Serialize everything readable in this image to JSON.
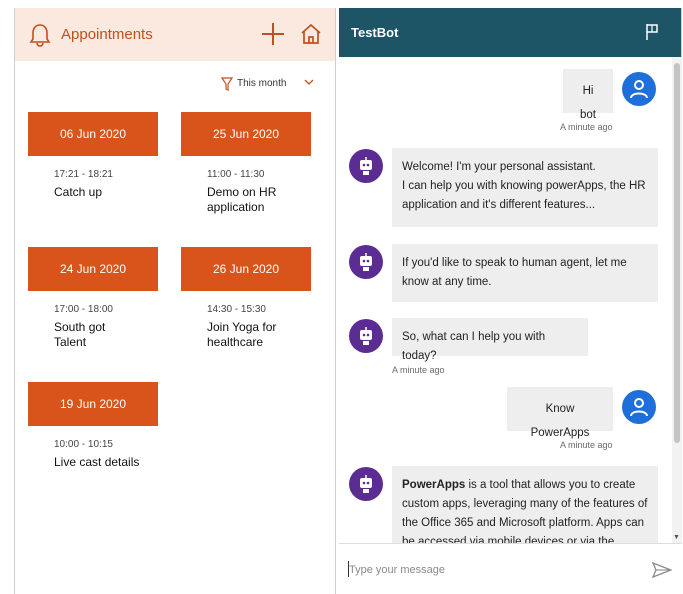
{
  "appointments": {
    "title": "Appointments",
    "filter_label": "This month",
    "items": [
      {
        "date": "06 Jun 2020",
        "time": "17:21 - 18:21",
        "name": "Catch up"
      },
      {
        "date": "25 Jun 2020",
        "time": "11:00 - 11:30",
        "name": "Demo on HR\napplication"
      },
      {
        "date": "24 Jun 2020",
        "time": "17:00 - 18:00",
        "name": "South got\nTalent"
      },
      {
        "date": "26 Jun 2020",
        "time": "14:30 - 15:30",
        "name": "Join Yoga for\nhealthcare"
      },
      {
        "date": "19 Jun 2020",
        "time": "10:00 - 10:15",
        "name": "Live cast details"
      }
    ],
    "icons": {
      "bell": "bell-icon",
      "add": "plus-icon",
      "home": "home-icon",
      "filter": "filter-icon",
      "chevron": "chevron-down-icon"
    },
    "colors": {
      "header_bg": "#fbe9df",
      "accent": "#d9541b"
    }
  },
  "bot": {
    "title": "TestBot",
    "icons": {
      "flag": "flag-icon",
      "send": "send-icon",
      "user_avatar": "user-avatar-icon",
      "bot_avatar": "robot-icon"
    },
    "colors": {
      "header_bg": "#1d5466",
      "user_avatar": "#1e6fd9",
      "bot_avatar": "#5b2c91"
    },
    "messages": [
      {
        "from": "user",
        "text": "Hi bot",
        "timestamp": "A minute ago"
      },
      {
        "from": "bot",
        "text": "Welcome! I'm your personal assistant.\nI can help you with knowing powerApps, the HR application and it's different features..."
      },
      {
        "from": "bot",
        "text": "If you'd like to speak to human agent, let me know at any time."
      },
      {
        "from": "bot",
        "text": "So, what can I help you with today?",
        "timestamp": "A minute ago"
      },
      {
        "from": "user",
        "text": "Know PowerApps",
        "timestamp": "A minute ago"
      },
      {
        "from": "bot",
        "bold": "PowerApps",
        "text": " is a tool that allows you to create custom apps, leveraging many of the features of the Office 365 and Microsoft platform. Apps can be accessed via mobile devices or via the"
      }
    ],
    "input_placeholder": "Type your message"
  }
}
